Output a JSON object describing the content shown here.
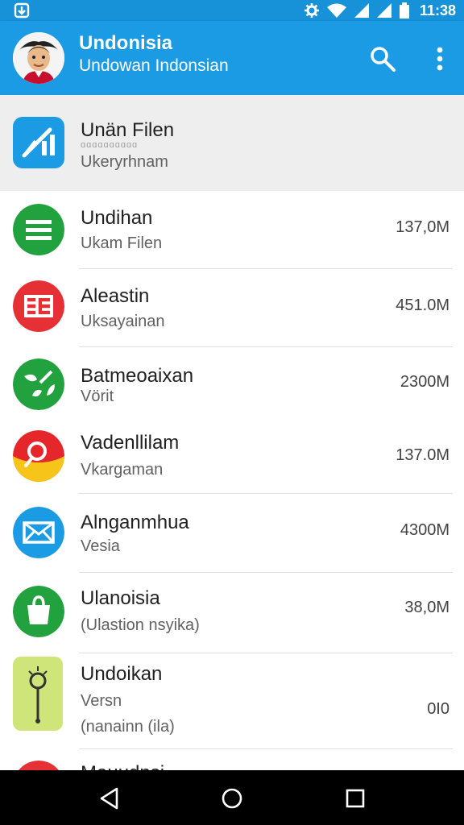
{
  "status_bar": {
    "time": "11:38",
    "icons": [
      "notification-icon",
      "settings-icon",
      "wifi-icon",
      "signal-icon",
      "signal-icon",
      "battery-icon"
    ]
  },
  "app_bar": {
    "title": "Undonisia",
    "subtitle": "Undowan Indonsian",
    "avatar": "person-avatar",
    "actions": [
      "search-icon",
      "more-vert-icon"
    ],
    "color": "#1c9be5"
  },
  "rows": [
    {
      "name": "Unän Filen",
      "tiny": "ɑɑɑɑɑɑɑɑɑɑ",
      "sub": "Ukeryrhnam",
      "size": "",
      "icon": "chart-app-icon",
      "color": "#1c9be5"
    },
    {
      "name": "Undihan",
      "sub": "Ukam Filen",
      "size": "137,0M",
      "icon": "list-app-icon",
      "color": "#21a23f"
    },
    {
      "name": "Aleastin",
      "sub": "Uksayainan",
      "size": "451.0M",
      "icon": "grid-app-icon",
      "color": "#e53035"
    },
    {
      "name": "Batmeoaixan",
      "sub": "Vörit",
      "size": "2300M",
      "icon": "leaf-app-icon",
      "color": "#21a23f"
    },
    {
      "name": "Vadenllilam",
      "sub": "Vkargaman",
      "size": "137.0M",
      "icon": "search-app-icon",
      "color": "#e5262b"
    },
    {
      "name": "Alnganmhua",
      "sub": "Vesia",
      "size": "4300M",
      "icon": "mail-app-icon",
      "color": "#1c9be5"
    },
    {
      "name": "Ulanoisia",
      "sub": "(Ulastion nsyika)",
      "size": "38,0M",
      "icon": "bag-app-icon",
      "color": "#21a23f"
    },
    {
      "name": "Undoikan",
      "sub": "Versn",
      "sub2": "(nanainn (ila)",
      "size": "0I0",
      "icon": "tool-app-icon",
      "color": "#cfe57a"
    },
    {
      "name": "Mauudnsi",
      "sub": "",
      "size": "",
      "icon": "red-app-icon",
      "color": "#e53035"
    }
  ],
  "nav_bar": {
    "buttons": [
      "back-icon",
      "home-icon",
      "recents-icon"
    ]
  }
}
